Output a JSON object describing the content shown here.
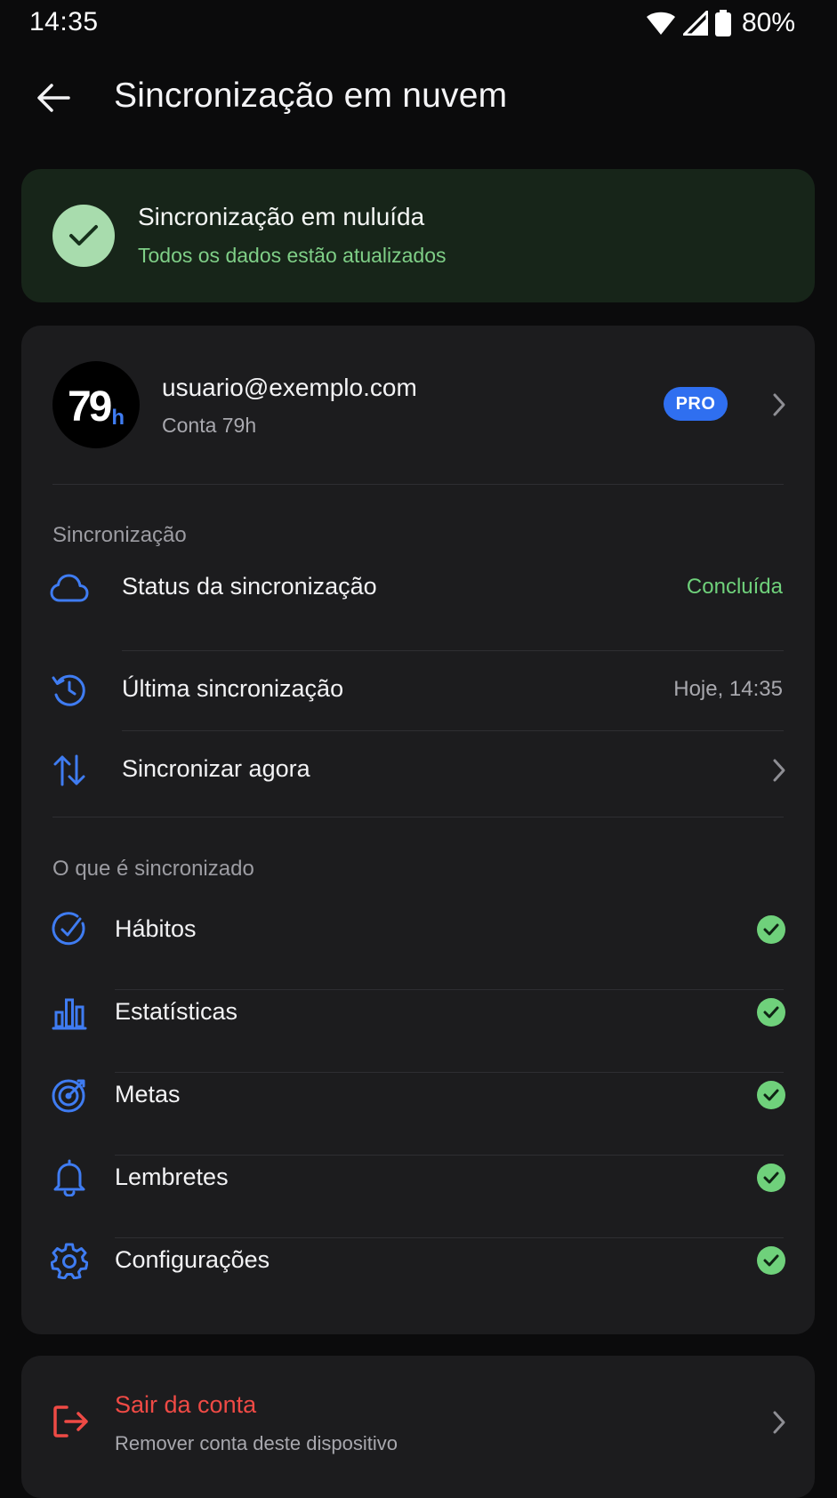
{
  "status_bar": {
    "time": "14:35",
    "battery_percent": "80%",
    "icons": [
      "wifi-icon",
      "signal-icon",
      "battery-icon"
    ]
  },
  "header": {
    "title": "Sincronização em nuvem",
    "back_icon": "arrow-left-icon"
  },
  "banner": {
    "title": "Sincronização em nuluída",
    "subtitle": "Todos os dados estão atualizados",
    "icon": "check-circle-icon"
  },
  "account": {
    "avatar_main": "79",
    "avatar_sub": "h",
    "email": "usuario@exemplo.com",
    "type": "Conta 79h",
    "badge": "PRO"
  },
  "sync_section": {
    "label": "Sincronização",
    "items": [
      {
        "label": "Status da sincronização",
        "value": "Concluída",
        "icon": "cloud-icon"
      },
      {
        "label": "Última sincronização",
        "value": "Hoje, 14:35",
        "icon": "history-icon"
      },
      {
        "label": "Sincronizar agora",
        "icon": "sync-arrows-icon"
      }
    ]
  },
  "synced_section": {
    "label": "O que é sincronizado",
    "items": [
      {
        "label": "Hábitos",
        "icon": "habit-check-icon",
        "synced": true
      },
      {
        "label": "Estatísticas",
        "icon": "bar-chart-icon",
        "synced": true
      },
      {
        "label": "Metas",
        "icon": "target-icon",
        "synced": true
      },
      {
        "label": "Lembretes",
        "icon": "bell-icon",
        "synced": true
      },
      {
        "label": "Configurações",
        "icon": "gear-icon",
        "synced": true
      }
    ]
  },
  "logout": {
    "title": "Sair da conta",
    "subtitle": "Remover conta deste dispositivo",
    "icon": "logout-icon"
  },
  "colors": {
    "background": "#0b0b0c",
    "card": "#1c1c1e",
    "banner_bg": "#172519",
    "accent_blue": "#3f7cf2",
    "success_green": "#6fd17b",
    "danger_red": "#ef4a45"
  }
}
